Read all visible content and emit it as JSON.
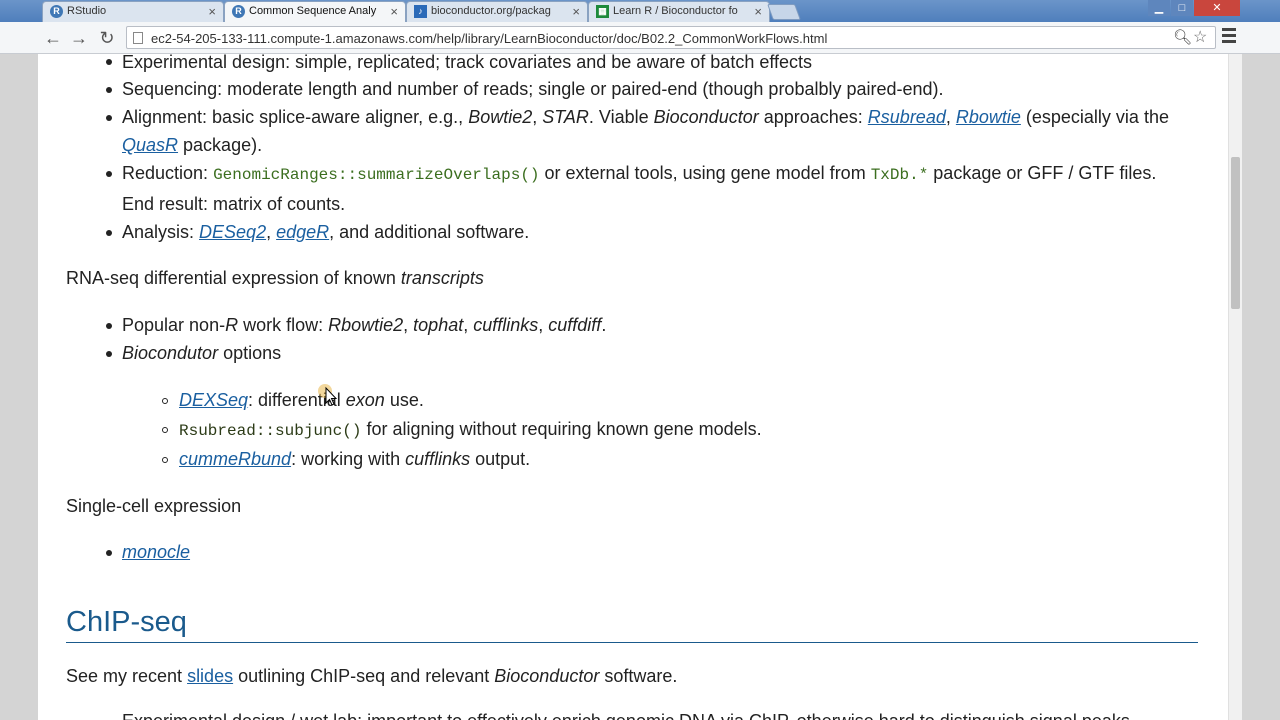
{
  "browser": {
    "tabs": [
      {
        "title": "RStudio",
        "icon": "R",
        "icon_color": "#3f77b5"
      },
      {
        "title": "Common Sequence Analy",
        "icon": "R",
        "icon_color": "#3f77b5"
      },
      {
        "title": "bioconductor.org/packag",
        "icon": "note",
        "icon_color": "#2b6ab8"
      },
      {
        "title": "Learn R / Bioconductor fo",
        "icon": "sheet",
        "icon_color": "#1e8a3b"
      }
    ],
    "url": "ec2-54-205-133-111.compute-1.amazonaws.com/help/library/LearnBioconductor/doc/B02.2_CommonWorkFlows.html"
  },
  "content": {
    "rnaseq_gene_list": [
      {
        "id": "exp",
        "text": "Experimental design: simple, replicated; track covariates and be aware of batch effects"
      },
      {
        "id": "seq",
        "text": "Sequencing: moderate length and number of reads; single or paired-end (though probalbly paired-end)."
      },
      {
        "id": "align",
        "a": "Alignment: basic splice-aware aligner, e.g., ",
        "b": "Bowtie2",
        "c": ", ",
        "d": "STAR",
        "e": ". Viable ",
        "f": "Bioconductor",
        "g": " approaches: ",
        "l1": "Rsubread",
        "sep": ", ",
        "l2": "Rbowtie",
        "h": " (especially via the",
        "l3": "QuasR",
        "i": " package)."
      },
      {
        "id": "red",
        "a": "Reduction: ",
        "code1": "GenomicRanges::summarizeOverlaps()",
        "b": " or external tools, using gene model from ",
        "code2": "TxDb.*",
        "c": " package or GFF / GTF files.",
        "line2": "End result: matrix of counts."
      },
      {
        "id": "ana",
        "a": "Analysis: ",
        "l1": "DESeq2",
        "sep": ", ",
        "l2": "edgeR",
        "b": ", and additional software."
      }
    ],
    "transcripts_heading": {
      "a": "RNA-seq differential expression of known ",
      "b": "transcripts"
    },
    "transcripts_list": [
      {
        "a": "Popular non-",
        "b": "R",
        "c": " work flow: ",
        "d": "Rbowtie2",
        "e": ", ",
        "f": "tophat",
        "g": ", ",
        "h": "cufflinks",
        "i": ", ",
        "j": "cuffdiff",
        "k": "."
      },
      {
        "a": "Biocondutor",
        "b": " options"
      }
    ],
    "bioc_options": [
      {
        "link": "DEXSeq",
        "a": ": differential ",
        "b": "exon",
        "c": " use."
      },
      {
        "code": "Rsubread::subjunc()",
        "a": " for aligning without requiring known gene models."
      },
      {
        "link": "cummeRbund",
        "a": ": working with ",
        "b": "cufflinks",
        "c": " output."
      }
    ],
    "single_cell_heading": "Single-cell expression",
    "single_cell_list": [
      "monocle"
    ],
    "chipseq_heading": "ChIP-seq",
    "chipseq_intro": {
      "a": "See my recent ",
      "link": "slides",
      "b": " outlining ChIP-seq and relevant ",
      "c": "Bioconductor",
      "d": " software."
    },
    "chipseq_cut_line": "Experimental design / wet lab: important to effectively enrich genomic DNA via ChIP, otherwise hard to distinguish signal peaks"
  }
}
